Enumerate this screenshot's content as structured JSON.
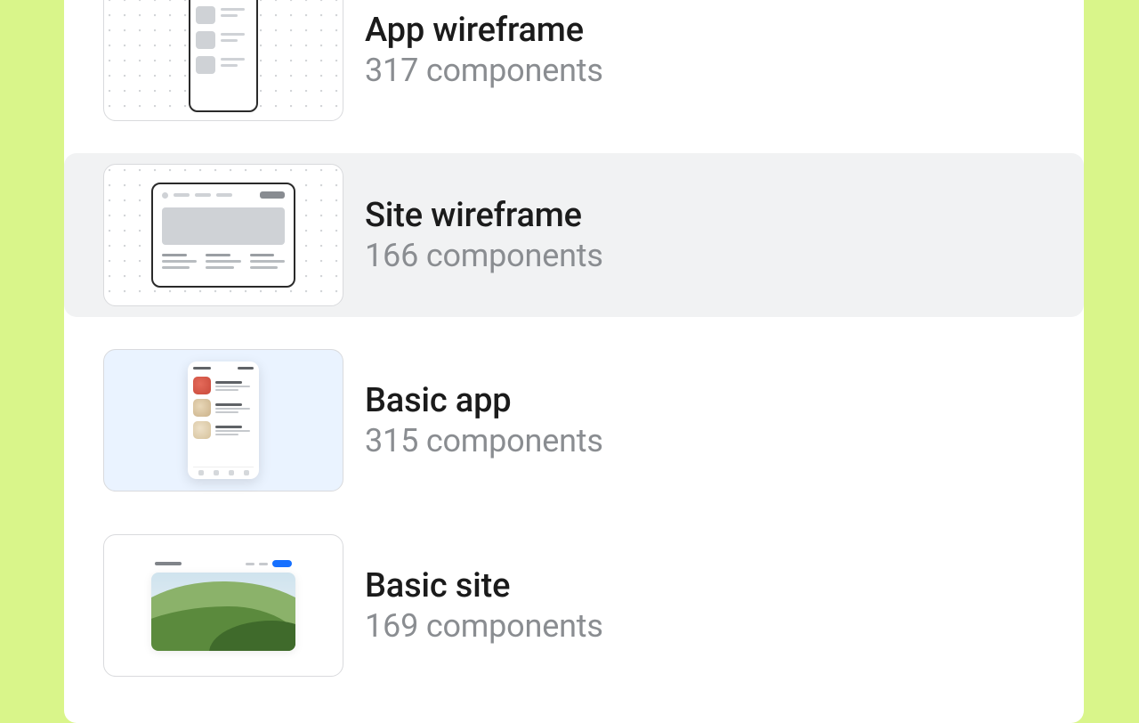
{
  "templates": [
    {
      "key": "app-wireframe",
      "title": "App wireframe",
      "sub": "317 components",
      "selected": false
    },
    {
      "key": "site-wireframe",
      "title": "Site wireframe",
      "sub": "166 components",
      "selected": true
    },
    {
      "key": "basic-app",
      "title": "Basic app",
      "sub": "315 components",
      "selected": false
    },
    {
      "key": "basic-site",
      "title": "Basic site",
      "sub": "169 components",
      "selected": false
    }
  ]
}
